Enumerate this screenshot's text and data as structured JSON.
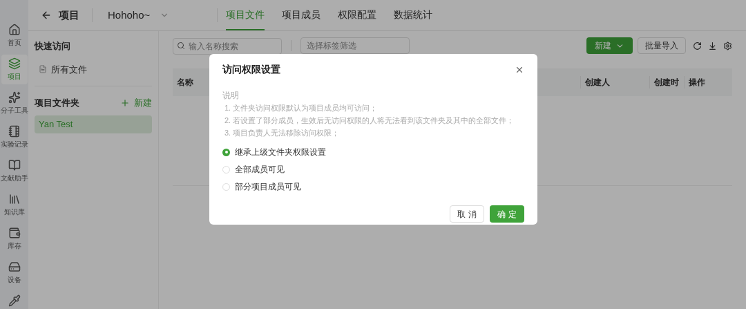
{
  "nav": [
    {
      "label": "首页",
      "selected": false,
      "kind": "home"
    },
    {
      "label": "项目",
      "selected": true,
      "kind": "layers"
    },
    {
      "label": "分子工具",
      "selected": false,
      "kind": "tool"
    },
    {
      "label": "实验记录",
      "selected": false,
      "kind": "notebook"
    },
    {
      "label": "文献助手",
      "selected": false,
      "kind": "book"
    },
    {
      "label": "知识库",
      "selected": false,
      "kind": "library"
    },
    {
      "label": "库存",
      "selected": false,
      "kind": "wallet"
    },
    {
      "label": "设备",
      "selected": false,
      "kind": "device"
    },
    {
      "kind": "pipette",
      "selected": false
    }
  ],
  "header": {
    "back": "项目",
    "project": "Hohoho~",
    "tabs": [
      {
        "label": "项目文件",
        "selected": true
      },
      {
        "label": "项目成员",
        "selected": false
      },
      {
        "label": "权限配置",
        "selected": false
      },
      {
        "label": "数据统计",
        "selected": false
      }
    ]
  },
  "folder_panel": {
    "quick_title": "快速访问",
    "all_files": "所有文件",
    "folders_title": "项目文件夹",
    "new": "新建",
    "folders": [
      {
        "label": "Yan Test",
        "selected": true
      }
    ]
  },
  "toolbar": {
    "search": {
      "placeholder": "输入名称搜索"
    },
    "tag_filter": {
      "placeholder": "选择标签筛选"
    },
    "new": "新建",
    "import": "批量导入"
  },
  "table": {
    "columns": [
      "名称",
      "创建人",
      "创建时",
      "操作"
    ]
  },
  "dialog": {
    "title": "访问权限设置",
    "note_title": "说明",
    "notes": [
      "1. 文件夹访问权限默认为项目成员均可访问；",
      "2. 若设置了部分成员，生效后无访问权限的人将无法看到该文件夹及其中的全部文件；",
      "3. 项目负责人无法移除访问权限；"
    ],
    "options": [
      {
        "label": "继承上级文件夹权限设置",
        "selected": true
      },
      {
        "label": "全部成员可见",
        "selected": false
      },
      {
        "label": "部分项目成员可见",
        "selected": false
      }
    ],
    "cancel": "取 消",
    "ok": "确 定"
  }
}
